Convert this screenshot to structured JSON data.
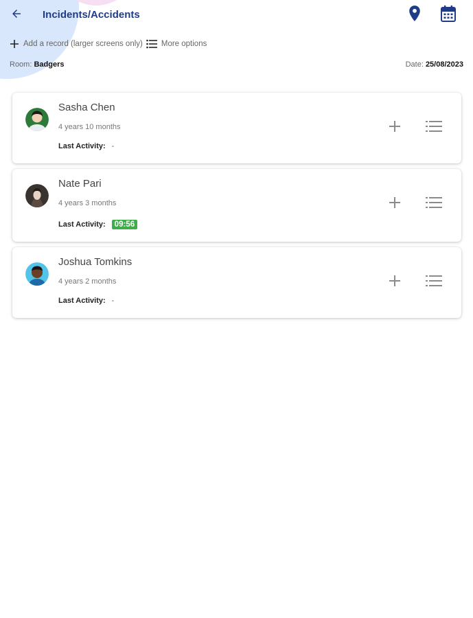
{
  "header": {
    "title": "Incidents/Accidents",
    "back_icon": "arrow-left-icon",
    "location_icon": "map-pin-icon",
    "calendar_icon": "calendar-icon",
    "accent_color": "#1f3d86"
  },
  "toolbar": {
    "add_record_label": "Add a record (larger screens only)",
    "more_options_label": "More options"
  },
  "info": {
    "room_label": "Room:",
    "room_value": "Badgers",
    "date_label": "Date:",
    "date_value": "25/08/2023"
  },
  "children": [
    {
      "name": "Sasha Chen",
      "age": "4 years 10 months",
      "last_activity_label": "Last Activity:",
      "last_activity": "-"
    },
    {
      "name": "Nate Pari",
      "age": "4 years 3 months",
      "last_activity_label": "Last Activity:",
      "last_activity": "09:56",
      "badge_color": "#3fae4a"
    },
    {
      "name": "Joshua Tomkins",
      "age": "4 years 2 months",
      "last_activity_label": "Last Activity:",
      "last_activity": "-"
    }
  ]
}
